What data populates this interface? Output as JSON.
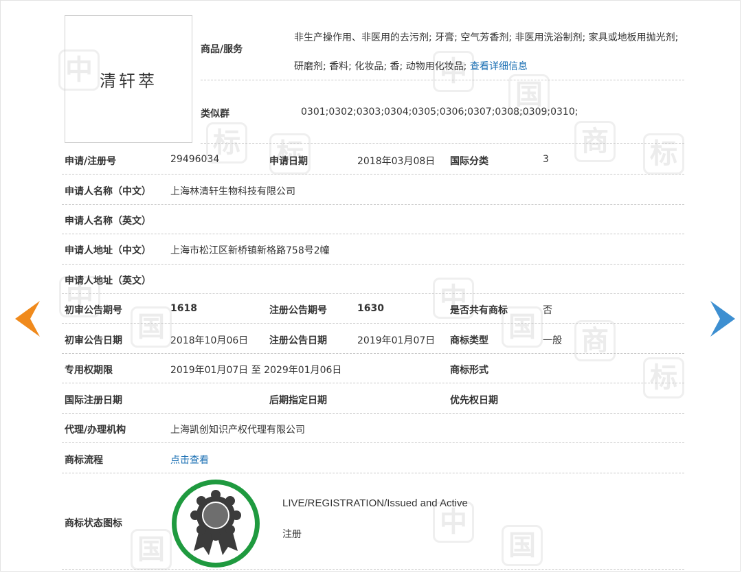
{
  "watermark": {
    "glyphs": [
      "中",
      "国",
      "商",
      "标",
      "中",
      "国",
      "商",
      "标",
      "中",
      "国",
      "商",
      "标",
      "中",
      "国",
      "商",
      "标"
    ]
  },
  "nav": {
    "prev_color": "#f08a1c",
    "next_color": "#3d8fd1"
  },
  "logo": {
    "text": "清轩萃"
  },
  "header": {
    "goods_label": "商品/服务",
    "goods_text": "非生产操作用、非医用的去污剂; 牙膏; 空气芳香剂; 非医用洗浴制剂; 家具或地板用抛光剂; 研磨剂; 香料; 化妆品; 香; 动物用化妆品;",
    "goods_link": "查看详细信息",
    "similar_label": "类似群",
    "similar_value": "0301;0302;0303;0304;0305;0306;0307;0308;0309;0310;"
  },
  "rows": {
    "reg_no_label": "申请/注册号",
    "reg_no": "29496034",
    "apply_date_label": "申请日期",
    "apply_date": "2018年03月08日",
    "intl_class_label": "国际分类",
    "intl_class": "3",
    "applicant_cn_label": "申请人名称（中文）",
    "applicant_cn": "上海林清轩生物科技有限公司",
    "applicant_en_label": "申请人名称（英文）",
    "address_cn_label": "申请人地址（中文）",
    "address_cn": "上海市松江区新桥镇新格路758号2幢",
    "address_en_label": "申请人地址（英文）",
    "prelim_no_label": "初审公告期号",
    "prelim_no": "1618",
    "reg_pub_no_label": "注册公告期号",
    "reg_pub_no": "1630",
    "shared_label": "是否共有商标",
    "shared": "否",
    "prelim_date_label": "初审公告日期",
    "prelim_date": "2018年10月06日",
    "reg_pub_date_label": "注册公告日期",
    "reg_pub_date": "2019年01月07日",
    "tm_type_label": "商标类型",
    "tm_type": "一般",
    "exclusive_label": "专用权期限",
    "exclusive": "2019年01月07日 至 2029年01月06日",
    "tm_form_label": "商标形式",
    "intl_reg_date_label": "国际注册日期",
    "later_date_label": "后期指定日期",
    "priority_label": "优先权日期",
    "agent_label": "代理/办理机构",
    "agent": "上海凯创知识产权代理有限公司",
    "flow_label": "商标流程",
    "flow_link": "点击查看",
    "status_label": "商标状态图标",
    "status_en": "LIVE/REGISTRATION/Issued and Active",
    "status_cn": "注册"
  },
  "colors": {
    "link": "#1a6fb3",
    "seal_ring": "#1f9a3f",
    "seal_badge": "#3b3b3b"
  }
}
